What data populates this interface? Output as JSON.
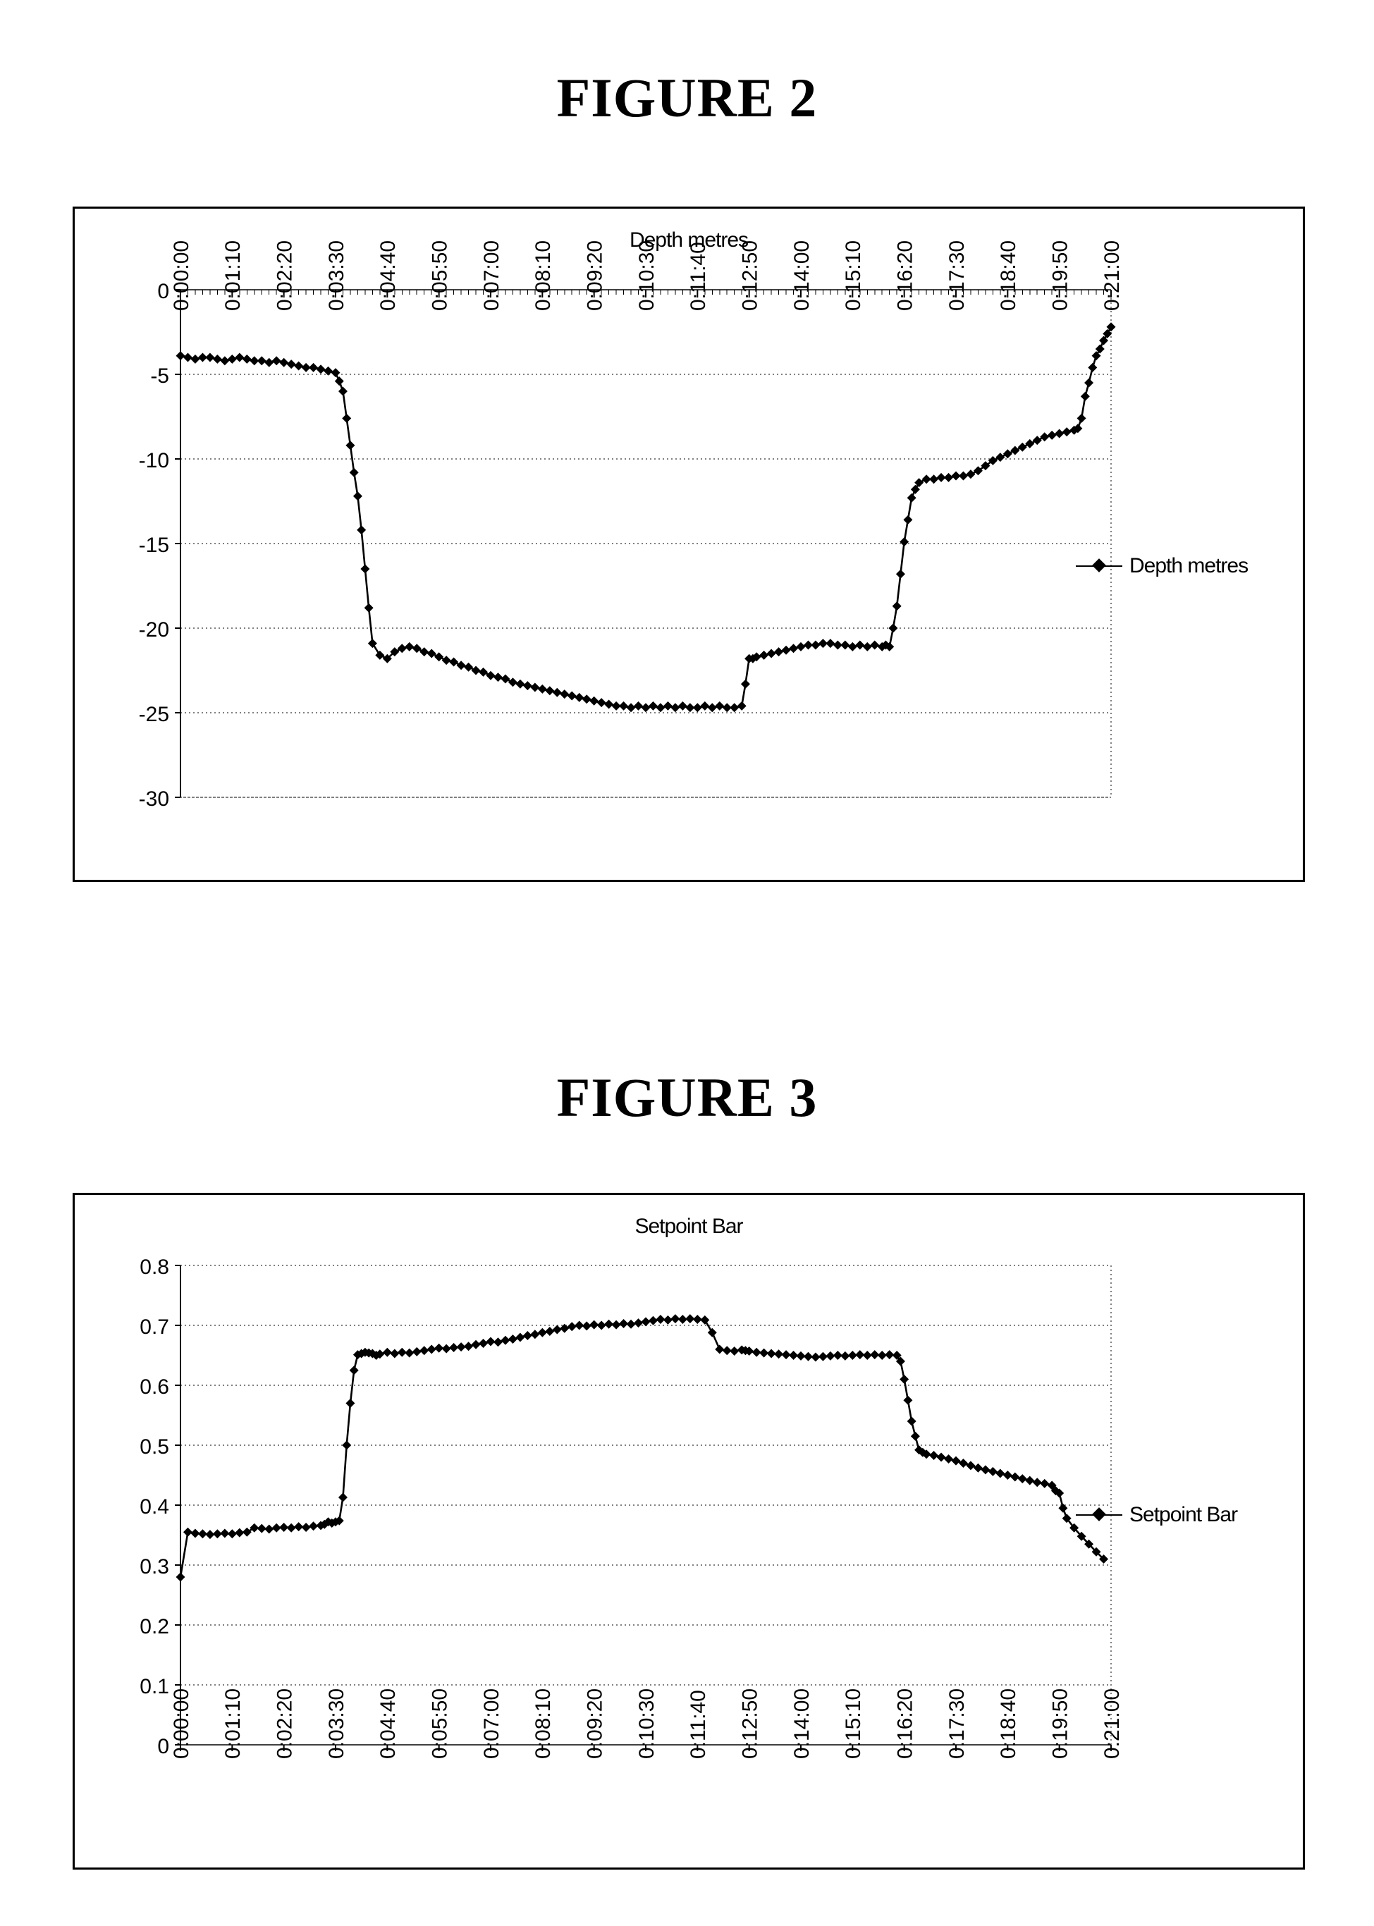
{
  "document": {
    "figure2_heading": "FIGURE 2",
    "figure3_heading": "FIGURE 3"
  },
  "figure2": {
    "chart_title": "Depth metres",
    "legend_label": "Depth metres"
  },
  "figure3": {
    "chart_title": "Setpoint Bar",
    "legend_label": "Setpoint Bar"
  },
  "chart_data": [
    {
      "id": "figure2-depth",
      "type": "line",
      "title": "Depth metres",
      "xlabel": "",
      "ylabel": "",
      "legend": [
        "Depth metres"
      ],
      "legend_position": "right",
      "grid": true,
      "marker": "diamond",
      "line_color": "#000000",
      "ylim": [
        -30,
        0
      ],
      "yticks": [
        0,
        -5,
        -10,
        -15,
        -20,
        -25,
        -30
      ],
      "ytick_labels": [
        "0",
        "-5",
        "-10",
        "-15",
        "-20",
        "-25",
        "-30"
      ],
      "xlim": [
        0,
        1260
      ],
      "xtick_seconds": [
        0,
        70,
        140,
        210,
        280,
        350,
        420,
        490,
        560,
        630,
        700,
        770,
        840,
        910,
        980,
        1050,
        1120,
        1190,
        1260
      ],
      "xtick_labels": [
        "0:00:00",
        "0:01:10",
        "0:02:20",
        "0:03:30",
        "0:04:40",
        "0:05:50",
        "0:07:00",
        "0:08:10",
        "0:09:20",
        "0:10:30",
        "0:11:40",
        "0:12:50",
        "0:14:00",
        "0:15:10",
        "0:16:20",
        "0:17:30",
        "0:18:40",
        "0:19:50",
        "0:21:00"
      ],
      "x": [
        0,
        10,
        20,
        30,
        40,
        50,
        60,
        70,
        80,
        90,
        100,
        110,
        120,
        130,
        140,
        150,
        160,
        170,
        180,
        190,
        200,
        210,
        215,
        220,
        225,
        230,
        235,
        240,
        245,
        250,
        255,
        260,
        270,
        280,
        290,
        300,
        310,
        320,
        330,
        340,
        350,
        360,
        370,
        380,
        390,
        400,
        410,
        420,
        430,
        440,
        450,
        460,
        470,
        480,
        490,
        500,
        510,
        520,
        530,
        540,
        550,
        560,
        570,
        580,
        590,
        600,
        610,
        620,
        630,
        640,
        650,
        660,
        670,
        680,
        690,
        700,
        710,
        720,
        730,
        740,
        750,
        760,
        765,
        770,
        775,
        780,
        790,
        800,
        810,
        820,
        830,
        840,
        850,
        860,
        870,
        880,
        890,
        900,
        910,
        920,
        930,
        940,
        950,
        955,
        960,
        965,
        970,
        975,
        980,
        985,
        990,
        995,
        1000,
        1010,
        1020,
        1030,
        1040,
        1050,
        1060,
        1070,
        1080,
        1090,
        1100,
        1110,
        1120,
        1130,
        1140,
        1150,
        1160,
        1170,
        1180,
        1190,
        1200,
        1210,
        1215,
        1220,
        1225,
        1230,
        1235,
        1240,
        1245,
        1250,
        1255,
        1260
      ],
      "y": [
        -3.9,
        -4.0,
        -4.1,
        -4.0,
        -4.0,
        -4.1,
        -4.2,
        -4.1,
        -4.0,
        -4.1,
        -4.2,
        -4.2,
        -4.3,
        -4.2,
        -4.3,
        -4.4,
        -4.5,
        -4.6,
        -4.6,
        -4.7,
        -4.8,
        -4.9,
        -5.4,
        -6.0,
        -7.6,
        -9.2,
        -10.8,
        -12.2,
        -14.2,
        -16.5,
        -18.8,
        -20.9,
        -21.6,
        -21.8,
        -21.4,
        -21.2,
        -21.1,
        -21.2,
        -21.4,
        -21.5,
        -21.7,
        -21.9,
        -22.0,
        -22.2,
        -22.3,
        -22.5,
        -22.6,
        -22.8,
        -22.9,
        -23.0,
        -23.2,
        -23.3,
        -23.4,
        -23.5,
        -23.6,
        -23.7,
        -23.8,
        -23.9,
        -24.0,
        -24.1,
        -24.2,
        -24.3,
        -24.4,
        -24.5,
        -24.6,
        -24.6,
        -24.7,
        -24.6,
        -24.7,
        -24.6,
        -24.7,
        -24.6,
        -24.7,
        -24.6,
        -24.7,
        -24.7,
        -24.6,
        -24.7,
        -24.6,
        -24.7,
        -24.7,
        -24.6,
        -23.3,
        -21.8,
        -21.8,
        -21.7,
        -21.6,
        -21.5,
        -21.4,
        -21.3,
        -21.2,
        -21.1,
        -21.0,
        -21.0,
        -20.9,
        -20.9,
        -21.0,
        -21.0,
        -21.1,
        -21.0,
        -21.1,
        -21.0,
        -21.1,
        -21.0,
        -21.1,
        -20.0,
        -18.7,
        -16.8,
        -14.9,
        -13.6,
        -12.3,
        -11.8,
        -11.4,
        -11.2,
        -11.2,
        -11.1,
        -11.1,
        -11.0,
        -11.0,
        -10.9,
        -10.7,
        -10.4,
        -10.1,
        -9.9,
        -9.7,
        -9.5,
        -9.3,
        -9.1,
        -8.9,
        -8.7,
        -8.6,
        -8.5,
        -8.4,
        -8.3,
        -8.2,
        -7.6,
        -6.3,
        -5.5,
        -4.6,
        -3.9,
        -3.5,
        -3.0,
        -2.6,
        -2.2,
        -1.9,
        -1.7
      ]
    },
    {
      "id": "figure3-setpoint",
      "type": "line",
      "title": "Setpoint Bar",
      "xlabel": "",
      "ylabel": "",
      "legend": [
        "Setpoint Bar"
      ],
      "legend_position": "right",
      "grid": true,
      "marker": "diamond",
      "line_color": "#000000",
      "ylim": [
        0,
        0.8
      ],
      "yticks": [
        0.8,
        0.7,
        0.6,
        0.5,
        0.4,
        0.3,
        0.2,
        0.1,
        0
      ],
      "ytick_labels": [
        "0.8",
        "0.7",
        "0.6",
        "0.5",
        "0.4",
        "0.3",
        "0.2",
        "0.1",
        "0"
      ],
      "xlim": [
        0,
        1260
      ],
      "xtick_seconds": [
        0,
        70,
        140,
        210,
        280,
        350,
        420,
        490,
        560,
        630,
        700,
        770,
        840,
        910,
        980,
        1050,
        1120,
        1190,
        1260
      ],
      "xtick_labels": [
        "0:00:00",
        "0:01:10",
        "0:02:20",
        "0:03:30",
        "0:04:40",
        "0:05:50",
        "0:07:00",
        "0:08:10",
        "0:09:20",
        "0:10:30",
        "0:11:40",
        "0:12:50",
        "0:14:00",
        "0:15:10",
        "0:16:20",
        "0:17:30",
        "0:18:40",
        "0:19:50",
        "0:21:00"
      ],
      "x": [
        0,
        10,
        20,
        30,
        40,
        50,
        60,
        70,
        80,
        90,
        100,
        110,
        120,
        130,
        140,
        150,
        160,
        170,
        180,
        190,
        195,
        200,
        205,
        210,
        215,
        220,
        225,
        230,
        235,
        240,
        245,
        250,
        255,
        260,
        265,
        270,
        280,
        290,
        300,
        310,
        320,
        330,
        340,
        350,
        360,
        370,
        380,
        390,
        400,
        410,
        420,
        430,
        440,
        450,
        460,
        470,
        480,
        490,
        500,
        510,
        520,
        530,
        540,
        550,
        560,
        570,
        580,
        590,
        600,
        610,
        620,
        630,
        640,
        650,
        660,
        670,
        680,
        690,
        700,
        710,
        720,
        730,
        740,
        750,
        760,
        765,
        770,
        780,
        790,
        800,
        810,
        820,
        830,
        840,
        850,
        860,
        870,
        880,
        890,
        900,
        910,
        920,
        930,
        940,
        950,
        960,
        970,
        975,
        980,
        985,
        990,
        995,
        1000,
        1005,
        1010,
        1020,
        1030,
        1040,
        1050,
        1060,
        1070,
        1080,
        1090,
        1100,
        1110,
        1120,
        1130,
        1140,
        1150,
        1160,
        1170,
        1180,
        1185,
        1190,
        1195,
        1200,
        1210,
        1220,
        1230,
        1240,
        1250,
        1260
      ],
      "y": [
        0.28,
        0.355,
        0.353,
        0.352,
        0.351,
        0.352,
        0.353,
        0.352,
        0.354,
        0.355,
        0.362,
        0.361,
        0.36,
        0.362,
        0.363,
        0.362,
        0.364,
        0.363,
        0.365,
        0.366,
        0.368,
        0.372,
        0.37,
        0.372,
        0.374,
        0.413,
        0.5,
        0.57,
        0.625,
        0.651,
        0.653,
        0.655,
        0.654,
        0.653,
        0.65,
        0.652,
        0.655,
        0.653,
        0.655,
        0.654,
        0.656,
        0.658,
        0.66,
        0.662,
        0.661,
        0.663,
        0.664,
        0.665,
        0.668,
        0.67,
        0.673,
        0.672,
        0.675,
        0.677,
        0.68,
        0.683,
        0.685,
        0.688,
        0.69,
        0.693,
        0.695,
        0.698,
        0.7,
        0.699,
        0.701,
        0.7,
        0.702,
        0.701,
        0.703,
        0.702,
        0.704,
        0.706,
        0.708,
        0.71,
        0.709,
        0.711,
        0.71,
        0.711,
        0.71,
        0.709,
        0.688,
        0.66,
        0.658,
        0.657,
        0.659,
        0.658,
        0.657,
        0.655,
        0.654,
        0.653,
        0.652,
        0.651,
        0.65,
        0.649,
        0.648,
        0.647,
        0.648,
        0.649,
        0.65,
        0.649,
        0.65,
        0.651,
        0.65,
        0.651,
        0.65,
        0.651,
        0.65,
        0.64,
        0.61,
        0.575,
        0.54,
        0.515,
        0.492,
        0.488,
        0.485,
        0.483,
        0.48,
        0.477,
        0.474,
        0.47,
        0.466,
        0.462,
        0.459,
        0.456,
        0.453,
        0.45,
        0.447,
        0.444,
        0.441,
        0.438,
        0.436,
        0.433,
        0.424,
        0.42,
        0.395,
        0.378,
        0.362,
        0.348,
        0.335,
        0.322,
        0.31
      ]
    }
  ]
}
